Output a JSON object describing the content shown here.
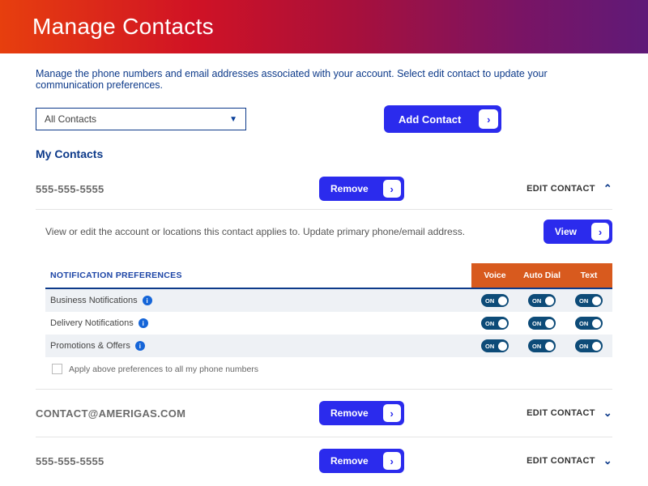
{
  "header": {
    "title": "Manage Contacts"
  },
  "intro": "Manage the phone numbers and email addresses associated with your account. Select edit contact to update your communication preferences.",
  "filter": {
    "selected": "All Contacts"
  },
  "buttons": {
    "add_contact": "Add Contact",
    "remove": "Remove",
    "view": "View",
    "edit_contact": "EDIT CONTACT"
  },
  "section_title": "My Contacts",
  "expand_desc": "View or edit the account or locations this contact applies to. Update primary phone/email address.",
  "contacts": [
    {
      "name": "555-555-5555",
      "expanded": true
    },
    {
      "name": "CONTACT@AMERIGAS.COM",
      "expanded": false
    },
    {
      "name": "555-555-5555",
      "expanded": false
    }
  ],
  "prefs": {
    "heading": "NOTIFICATION PREFERENCES",
    "cols": [
      "Voice",
      "Auto Dial",
      "Text"
    ],
    "rows": [
      {
        "label": "Business Notifications",
        "states": [
          "ON",
          "ON",
          "ON"
        ]
      },
      {
        "label": "Delivery Notifications",
        "states": [
          "ON",
          "ON",
          "ON"
        ]
      },
      {
        "label": "Promotions & Offers",
        "states": [
          "ON",
          "ON",
          "ON"
        ]
      }
    ],
    "apply_label": "Apply above preferences to all my phone numbers"
  }
}
